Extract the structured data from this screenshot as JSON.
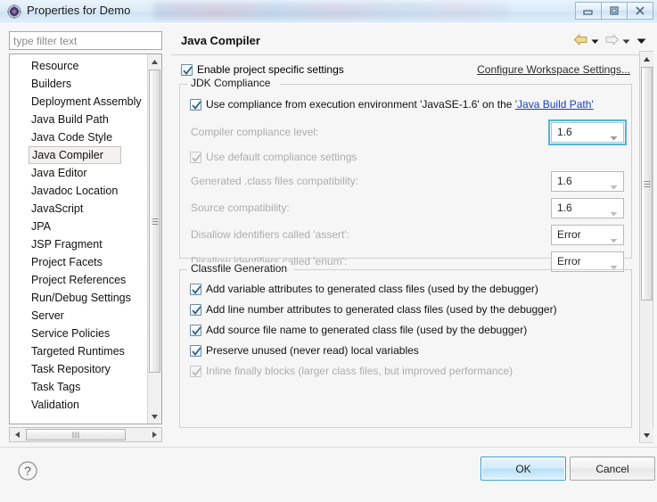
{
  "window": {
    "title": "Properties for Demo",
    "icon": "properties-gear-icon",
    "buttons": {
      "minimize": "minimize-icon",
      "maximize": "maximize-icon",
      "close": "close-icon"
    }
  },
  "sidebar": {
    "filter": {
      "placeholder": "type filter text",
      "value": ""
    },
    "selected": "Java Compiler",
    "items": [
      {
        "label": "Resource"
      },
      {
        "label": "Builders"
      },
      {
        "label": "Deployment Assembly"
      },
      {
        "label": "Java Build Path"
      },
      {
        "label": "Java Code Style"
      },
      {
        "label": "Java Compiler"
      },
      {
        "label": "Java Editor"
      },
      {
        "label": "Javadoc Location"
      },
      {
        "label": "JavaScript"
      },
      {
        "label": "JPA"
      },
      {
        "label": "JSP Fragment"
      },
      {
        "label": "Project Facets"
      },
      {
        "label": "Project References"
      },
      {
        "label": "Run/Debug Settings"
      },
      {
        "label": "Server"
      },
      {
        "label": "Service Policies"
      },
      {
        "label": "Targeted Runtimes"
      },
      {
        "label": "Task Repository"
      },
      {
        "label": "Task Tags"
      },
      {
        "label": "Validation"
      }
    ]
  },
  "panel": {
    "title": "Java Compiler",
    "nav": {
      "back": "back-arrow-icon",
      "back_menu": "chevron-down-icon",
      "forward": "forward-arrow-icon",
      "forward_menu": "chevron-down-icon",
      "view_menu": "chevron-down-icon"
    },
    "enable_project_specific": {
      "label": "Enable project specific settings",
      "checked": true
    },
    "configure_workspace_link": "Configure Workspace Settings...",
    "jdk_compliance": {
      "title": "JDK Compliance",
      "use_execution_env": {
        "prefix": "Use compliance from execution environment 'JavaSE-1.6' on the ",
        "link": "'Java Build Path'",
        "checked": true
      },
      "rows": [
        {
          "label": "Compiler compliance level:",
          "value": "1.6",
          "disabled": true,
          "focused": true
        },
        {
          "label": "Generated .class files compatibility:",
          "value": "1.6",
          "disabled": true,
          "focused": false
        },
        {
          "label": "Source compatibility:",
          "value": "1.6",
          "disabled": true,
          "focused": false
        },
        {
          "label": "Disallow identifiers called 'assert':",
          "value": "Error",
          "disabled": true,
          "focused": false
        },
        {
          "label": "Disallow identifiers called 'enum':",
          "value": "Error",
          "disabled": true,
          "focused": false
        }
      ],
      "use_default_settings": {
        "label": "Use default compliance settings",
        "checked": true,
        "disabled": true
      }
    },
    "classfile_generation": {
      "title": "Classfile Generation",
      "options": [
        {
          "label": "Add variable attributes to generated class files (used by the debugger)",
          "checked": true,
          "disabled": false
        },
        {
          "label": "Add line number attributes to generated class files (used by the debugger)",
          "checked": true,
          "disabled": false
        },
        {
          "label": "Add source file name to generated class file (used by the debugger)",
          "checked": true,
          "disabled": false
        },
        {
          "label": "Preserve unused (never read) local variables",
          "checked": true,
          "disabled": false
        },
        {
          "label": "Inline finally blocks (larger class files, but improved performance)",
          "checked": true,
          "disabled": true
        }
      ]
    }
  },
  "footer": {
    "help": "help-icon",
    "ok": "OK",
    "cancel": "Cancel"
  },
  "colors": {
    "titlebar": "#dcebf8",
    "accent_focus": "#58b3d4",
    "link_blue": "#1a3fbf",
    "disabled_text": "#adadad",
    "back_arrow": "#e8c56a"
  }
}
